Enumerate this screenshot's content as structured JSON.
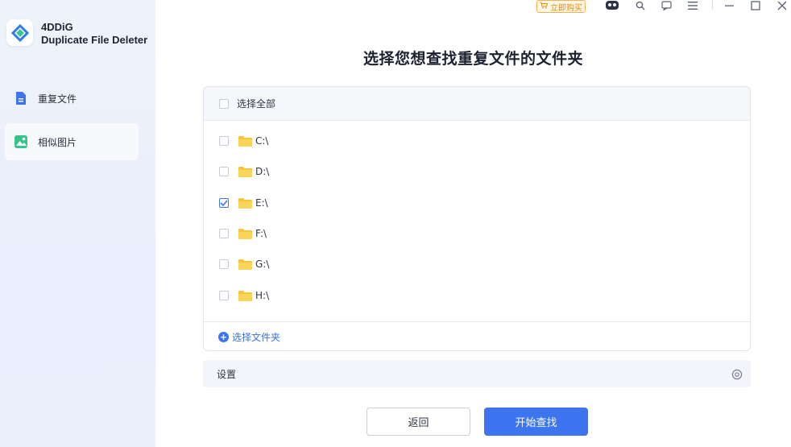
{
  "app": {
    "brand_name": "4DDiG",
    "brand_sub": "Duplicate File Deleter"
  },
  "titlebar": {
    "buy_label": "立即购买",
    "icons": [
      "cart-icon",
      "robot-icon",
      "search-icon",
      "feedback-icon",
      "menu-icon",
      "minimize-icon",
      "maximize-icon",
      "close-icon"
    ]
  },
  "sidebar": {
    "items": [
      {
        "label": "重复文件",
        "icon": "document-icon",
        "active": false
      },
      {
        "label": "相似图片",
        "icon": "image-icon",
        "active": true
      }
    ]
  },
  "main": {
    "title": "选择您想查找重复文件的文件夹",
    "select_all_label": "选择全部",
    "drives": [
      {
        "label": "C:\\",
        "checked": false
      },
      {
        "label": "D:\\",
        "checked": false
      },
      {
        "label": "E:\\",
        "checked": true
      },
      {
        "label": "F:\\",
        "checked": false
      },
      {
        "label": "G:\\",
        "checked": false
      },
      {
        "label": "H:\\",
        "checked": false
      }
    ],
    "add_folder_label": "选择文件夹",
    "settings_label": "设置",
    "back_label": "返回",
    "start_label": "开始查找"
  },
  "colors": {
    "accent": "#3d74f0",
    "folder": "#f8c53a",
    "buy": "#e08a12"
  }
}
